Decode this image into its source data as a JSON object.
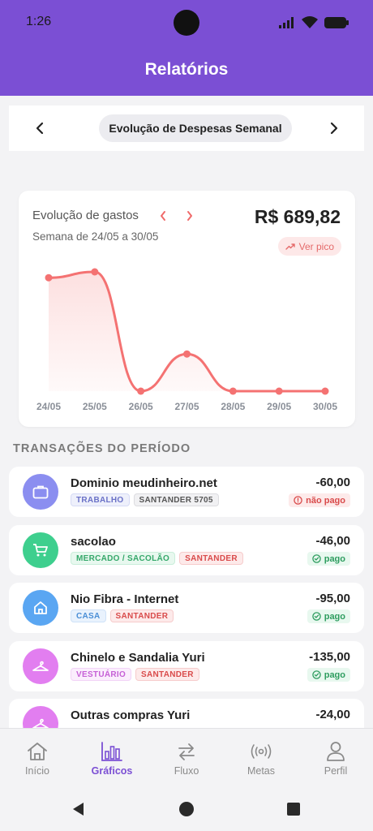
{
  "status_bar": {
    "time": "1:26"
  },
  "header": {
    "title": "Relatórios"
  },
  "report_selector": {
    "current": "Evolução de Despesas Semanal"
  },
  "chart_card": {
    "title": "Evolução de gastos",
    "subtitle": "Semana de 24/05 a 30/05",
    "total": "R$ 689,82",
    "peak_button": "Ver pico"
  },
  "chart_data": {
    "type": "area",
    "x": [
      "24/05",
      "25/05",
      "26/05",
      "27/05",
      "28/05",
      "29/05",
      "30/05"
    ],
    "values": [
      290,
      305,
      0,
      95,
      0,
      0,
      0
    ],
    "color": "#f47272"
  },
  "transactions_section": {
    "title": "TRANSAÇÕES DO PERÍODO"
  },
  "transactions": [
    {
      "name": "Dominio meudinheiro.net",
      "amount": "-60,00",
      "category": "TRABALHO",
      "account": "SANTANDER 5705",
      "status": "não pago",
      "icon": "briefcase-icon",
      "color": "#8b8ef0"
    },
    {
      "name": "sacolao",
      "amount": "-46,00",
      "category": "MERCADO / SACOLÃO",
      "account": "SANTANDER",
      "status": "pago",
      "icon": "cart-icon",
      "color": "#3ecf8e"
    },
    {
      "name": "Nio Fibra - Internet",
      "amount": "-95,00",
      "category": "CASA",
      "account": "SANTANDER",
      "status": "pago",
      "icon": "home-icon",
      "color": "#5aa6f2"
    },
    {
      "name": "Chinelo e Sandalia Yuri",
      "amount": "-135,00",
      "category": "VESTUÁRIO",
      "account": "SANTANDER",
      "status": "pago",
      "icon": "hanger-icon",
      "color": "#e27ef0"
    },
    {
      "name": "Outras compras Yuri",
      "amount": "-24,00",
      "category": "",
      "account": "",
      "status": "",
      "icon": "hanger-icon",
      "color": "#e27ef0"
    }
  ],
  "bottom_nav": [
    {
      "label": "Início",
      "icon": "home-icon"
    },
    {
      "label": "Gráficos",
      "icon": "bar-chart-icon",
      "active": true
    },
    {
      "label": "Fluxo",
      "icon": "swap-icon"
    },
    {
      "label": "Metas",
      "icon": "broadcast-icon"
    },
    {
      "label": "Perfil",
      "icon": "user-icon"
    }
  ]
}
